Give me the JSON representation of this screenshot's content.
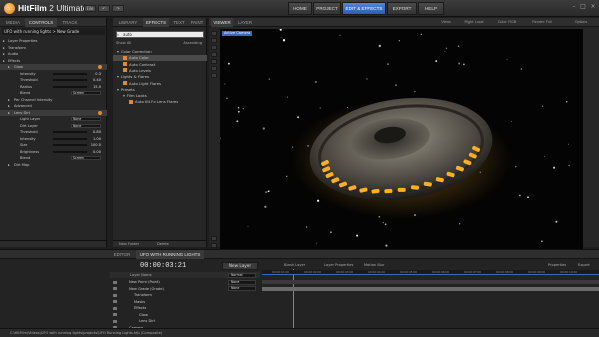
{
  "app": {
    "title_prefix": "HitFilm",
    "title_suffix": " 2 Ultimate",
    "file_label": "File"
  },
  "nav": [
    {
      "label": "HOME",
      "active": false
    },
    {
      "label": "PROJECT",
      "active": false
    },
    {
      "label": "EDIT & EFFECTS",
      "active": true
    },
    {
      "label": "EXPORT",
      "active": false
    },
    {
      "label": "HELP",
      "active": false
    }
  ],
  "left_panel": {
    "tabs": [
      "MEDIA",
      "CONTROLS",
      "TRACK"
    ],
    "breadcrumb": "UFO with running lights > New Grade",
    "rows": [
      {
        "label": "Layer Properties",
        "indent": 0,
        "value": ""
      },
      {
        "label": "Transform",
        "indent": 0,
        "value": ""
      },
      {
        "label": "Audio",
        "indent": 0,
        "value": ""
      },
      {
        "label": "Effects",
        "indent": 0,
        "value": ""
      },
      {
        "label": "Glow",
        "indent": 1,
        "value": "",
        "sel": true
      },
      {
        "label": "Intensity",
        "indent": 2,
        "value": "0.3",
        "slider": true
      },
      {
        "label": "Threshold",
        "indent": 2,
        "value": "0.40",
        "slider": true
      },
      {
        "label": "Radius",
        "indent": 2,
        "value": "15.0",
        "slider": true
      },
      {
        "label": "Blend",
        "indent": 2,
        "value": "Screen",
        "dropdown": true
      },
      {
        "label": "Per Channel Intensity",
        "indent": 1,
        "value": ""
      },
      {
        "label": "Advanced",
        "indent": 1,
        "value": ""
      },
      {
        "label": "Lens Dirt",
        "indent": 1,
        "value": "",
        "sel": true
      },
      {
        "label": "Light Layer",
        "indent": 2,
        "value": "None",
        "dropdown": true
      },
      {
        "label": "Dirt Layer",
        "indent": 2,
        "value": "None",
        "dropdown": true
      },
      {
        "label": "Threshold",
        "indent": 2,
        "value": "0.80",
        "slider": true
      },
      {
        "label": "Intensity",
        "indent": 2,
        "value": "1.00",
        "slider": true
      },
      {
        "label": "Size",
        "indent": 2,
        "value": "100.0",
        "slider": true
      },
      {
        "label": "Brightness",
        "indent": 2,
        "value": "0.00",
        "slider": true
      },
      {
        "label": "Blend",
        "indent": 2,
        "value": "Screen",
        "dropdown": true
      },
      {
        "label": "Dirt Map",
        "indent": 1,
        "value": ""
      }
    ]
  },
  "effects_panel": {
    "tabs": [
      "LIBRARY",
      "EFFECTS",
      "TEXT",
      "PAINT"
    ],
    "search_value": "auto",
    "group_label": "Show All",
    "sort_label": "Ascending",
    "rows": [
      {
        "label": "Color Correction",
        "indent": 0,
        "folder": true
      },
      {
        "label": "Auto Color",
        "indent": 1,
        "fx": true,
        "sel": true
      },
      {
        "label": "Auto Contrast",
        "indent": 1,
        "fx": true
      },
      {
        "label": "Auto Levels",
        "indent": 1,
        "fx": true
      },
      {
        "label": "Lights & Flares",
        "indent": 0,
        "folder": true
      },
      {
        "label": "Auto Light Flares",
        "indent": 1,
        "fx": true
      },
      {
        "label": "Presets",
        "indent": 0,
        "folder": true
      },
      {
        "label": "Film Looks",
        "indent": 1,
        "folder": true
      },
      {
        "label": "Auto Kit Fx Lens Flares",
        "indent": 2,
        "fx": true
      }
    ],
    "footer_left": "New Folder",
    "footer_right": "Delete"
  },
  "viewer": {
    "tabs": [
      "VIEWER",
      "LAYER"
    ],
    "tools": [
      "Views",
      "Right: Local",
      "Color: RGB",
      "Render: Full",
      "Options"
    ],
    "camera_label": "Active Camera",
    "timecode": "00:00:00;21",
    "zoom": "94.1%"
  },
  "timeline": {
    "tabs": [
      "EDITOR",
      "UFO WITH RUNNING LIGHTS"
    ],
    "timecode": "00:00:03:21",
    "new_layer_label": "New Layer",
    "toolbar": [
      "Blank Layer",
      "Layer Properties",
      "Motion Blur"
    ],
    "properties_label": "Properties",
    "export_label": "Export",
    "layer_name_header": "Layer Name",
    "layers": [
      {
        "label": "New Point (Point)",
        "indent": 1,
        "blend": ""
      },
      {
        "label": "New Grade (Grade)",
        "indent": 1,
        "blend": "Normal"
      },
      {
        "label": "Transform",
        "indent": 2,
        "blend": ""
      },
      {
        "label": "Masks",
        "indent": 2,
        "blend": ""
      },
      {
        "label": "Effects",
        "indent": 2,
        "blend": ""
      },
      {
        "label": "Glow",
        "indent": 3,
        "blend": ""
      },
      {
        "label": "Lens Dirt",
        "indent": 3,
        "blend": ""
      },
      {
        "label": "Camera",
        "indent": 1,
        "blend": ""
      }
    ],
    "blend_labels": [
      "Normal",
      "None",
      "None"
    ],
    "ruler": [
      "00:00:01:00",
      "00:00:02:00",
      "00:00:03:00",
      "00:00:04:00",
      "00:00:05:00",
      "00:00:06:00",
      "00:00:07:00",
      "00:00:08:00",
      "00:00:09:00",
      "00:00:10:00"
    ]
  },
  "status": "C:\\HitFilm\\Videos\\UFO with running lights\\projects\\UFO Running Lights.hfp (Composite)",
  "colors": {
    "accent": "#3a67c8",
    "orange": "#e08a2a",
    "ufo_light": "#ffb020"
  }
}
